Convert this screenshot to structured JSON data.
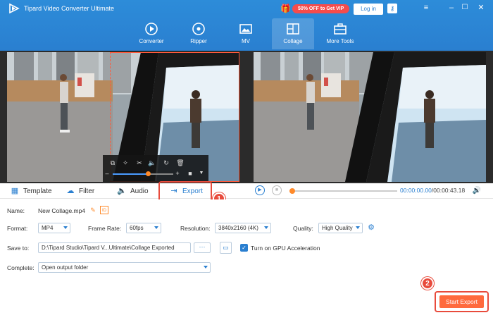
{
  "app": {
    "title": "Tipard Video Converter Ultimate"
  },
  "promo": {
    "text": "50% OFF to Get VIP"
  },
  "header": {
    "login_label": "Log in"
  },
  "nav": [
    {
      "label": "Converter",
      "icon": "converter-icon"
    },
    {
      "label": "Ripper",
      "icon": "ripper-icon"
    },
    {
      "label": "MV",
      "icon": "mv-icon"
    },
    {
      "label": "Collage",
      "icon": "collage-icon",
      "active": true
    },
    {
      "label": "More Tools",
      "icon": "toolbox-icon"
    }
  ],
  "tabs": [
    {
      "label": "Template",
      "icon": "template-icon"
    },
    {
      "label": "Filter",
      "icon": "filter-icon"
    },
    {
      "label": "Audio",
      "icon": "audio-icon"
    },
    {
      "label": "Export",
      "icon": "export-icon",
      "active": true
    }
  ],
  "playback": {
    "current": "00:00:00.00",
    "total": "/00:00:43.18"
  },
  "steps": {
    "one": "1",
    "two": "2"
  },
  "settings": {
    "name_label": "Name:",
    "name_value": "New Collage.mp4",
    "format_label": "Format:",
    "format_value": "MP4",
    "framerate_label": "Frame Rate:",
    "framerate_value": "60fps",
    "resolution_label": "Resolution:",
    "resolution_value": "3840x2160 (4K)",
    "quality_label": "Quality:",
    "quality_value": "High Quality",
    "saveto_label": "Save to:",
    "saveto_value": "D:\\Tipard Studio\\Tipard V...Ultimate\\Collage Exported",
    "saveto_more": "···",
    "gpu_label": "Turn on GPU Acceleration",
    "gpu_checked": true,
    "complete_label": "Complete:",
    "complete_value": "Open output folder"
  },
  "actions": {
    "start_export_label": "Start Export"
  },
  "colors": {
    "accent": "#2a7fd0",
    "highlight": "#e84b3c",
    "start": "#ff6a3d"
  }
}
